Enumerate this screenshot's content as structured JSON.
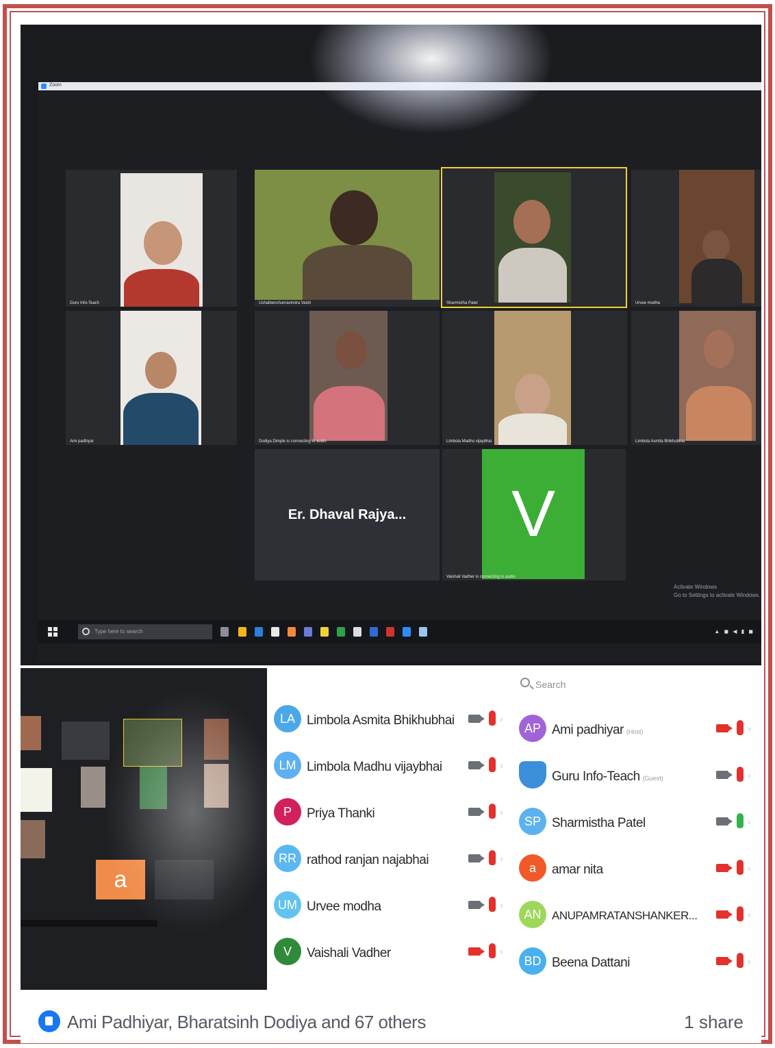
{
  "meeting": {
    "window_title": "Zoom",
    "tiles": [
      {
        "caption": "Guru Info-Teach"
      },
      {
        "caption": "Ushalbenchunravindra Vaish"
      },
      {
        "caption": "Sharmistha Patel"
      },
      {
        "caption": "Urvee modha"
      },
      {
        "caption": "Ami padhiyar"
      },
      {
        "caption": "Dodiya Dimple is connecting to audio"
      },
      {
        "caption": "Limbola Madhu vijaybhai"
      },
      {
        "caption": "Limbola Asmita Bhikhubhai"
      }
    ],
    "name_tile": "Er. Dhaval Rajya...",
    "avatar_tile_letter": "V",
    "avatar_tile_caption": "Vaishali Vadher is connecting to audio",
    "activate_line1": "Activate Windows",
    "activate_line2": "Go to Settings to activate Windows.",
    "taskbar_search": "Type here to search",
    "colors": {
      "active_border": "#f2d12f",
      "avatar_green": "#3cae35"
    }
  },
  "small_screenshot": {
    "avatar_letter": "a"
  },
  "participants_left": [
    {
      "initials": "LA",
      "name": "Limbola Asmita Bhikhubhai",
      "avatar_color": "#4aa8e8",
      "video": "off",
      "mic": "muted"
    },
    {
      "initials": "LM",
      "name": "Limbola Madhu vijaybhai",
      "avatar_color": "#5fb0f0",
      "video": "off",
      "mic": "muted"
    },
    {
      "initials": "P",
      "name": "Priya Thanki",
      "avatar_color": "#d1205b",
      "video": "off",
      "mic": "muted"
    },
    {
      "initials": "RR",
      "name": "rathod ranjan najabhai",
      "avatar_color": "#5bb7f2",
      "video": "off",
      "mic": "muted"
    },
    {
      "initials": "UM",
      "name": "Urvee modha",
      "avatar_color": "#62c3f0",
      "video": "off",
      "mic": "muted"
    },
    {
      "initials": "V",
      "name": "Vaishali Vadher",
      "avatar_color": "#2f8a3a",
      "video": "stopped",
      "mic": "muted"
    }
  ],
  "participants_right": {
    "search_placeholder": "Search",
    "items": [
      {
        "initials": "AP",
        "name": "Ami padhiyar",
        "tag": "(Host)",
        "avatar_color": "#a064d8",
        "video": "stopped",
        "mic": "muted"
      },
      {
        "initials": "",
        "name": "Guru Info-Teach",
        "tag": "(Guest)",
        "avatar_color": "#3a8fd8",
        "video": "off",
        "mic": "muted"
      },
      {
        "initials": "SP",
        "name": "Sharmistha Patel",
        "tag": "",
        "avatar_color": "#5cb2ee",
        "video": "off",
        "mic": "on"
      },
      {
        "initials": "a",
        "name": "amar nita",
        "tag": "",
        "avatar_color": "#f05a28",
        "video": "stopped",
        "mic": "muted"
      },
      {
        "initials": "AN",
        "name": "ANUPAMRATANSHANKER...",
        "tag": "",
        "avatar_color": "#9dd85a",
        "video": "stopped",
        "mic": "muted"
      },
      {
        "initials": "BD",
        "name": "Beena Dattani",
        "tag": "",
        "avatar_color": "#4ab0ee",
        "video": "stopped",
        "mic": "muted"
      }
    ]
  },
  "social": {
    "likes_text": "Ami Padhiyar, Bharatsinh Dodiya and 67 others",
    "shares_text": "1 share"
  }
}
